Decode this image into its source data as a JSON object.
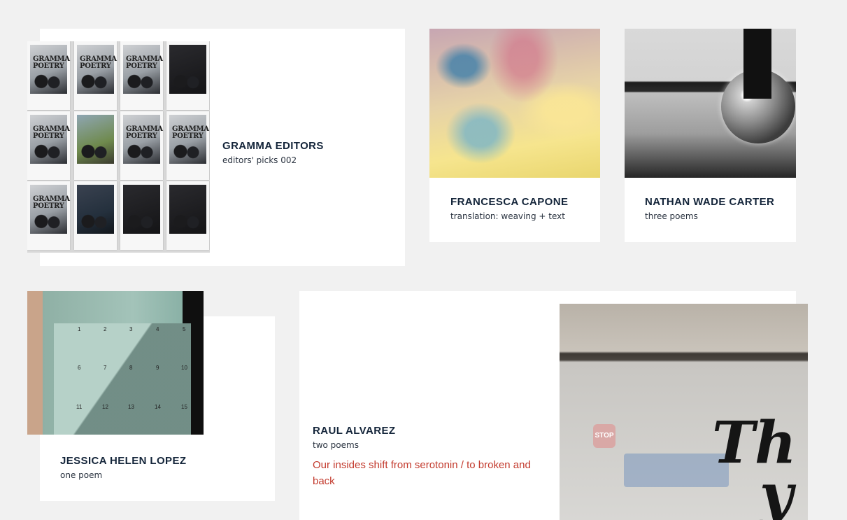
{
  "cards": [
    {
      "author": "GRAMMA EDITORS",
      "subtitle": "editors' picks 002",
      "image_icon": "polaroid-wall-photo"
    },
    {
      "author": "FRANCESCA CAPONE",
      "subtitle": "translation: weaving + text",
      "image_icon": "abstract-color-photo"
    },
    {
      "author": "NATHAN WADE CARTER",
      "subtitle": "three poems",
      "image_icon": "disco-ball-photo"
    },
    {
      "author": "JESSICA HELEN LOPEZ",
      "subtitle": "one poem",
      "image_icon": "mailbox-lockers-photo"
    },
    {
      "author": "RAUL ALVAREZ",
      "subtitle": "two poems",
      "excerpt": "Our insides shift from serotonin / to broken and back",
      "image_icon": "stop-sign-wall-photo"
    }
  ],
  "polaroid_tag": "GRAMMA POETRY",
  "locker_numbers": [
    "1",
    "2",
    "3",
    "4",
    "5",
    "6",
    "7",
    "8",
    "9",
    "10",
    "11",
    "12",
    "13",
    "14",
    "15"
  ],
  "stop_sign_text": "STOP",
  "mural_text": "Th",
  "mural_text_2": "y",
  "colors": {
    "background": "#f1f1f1",
    "card": "#ffffff",
    "author_text": "#14253a",
    "excerpt_text": "#c33a2d"
  }
}
